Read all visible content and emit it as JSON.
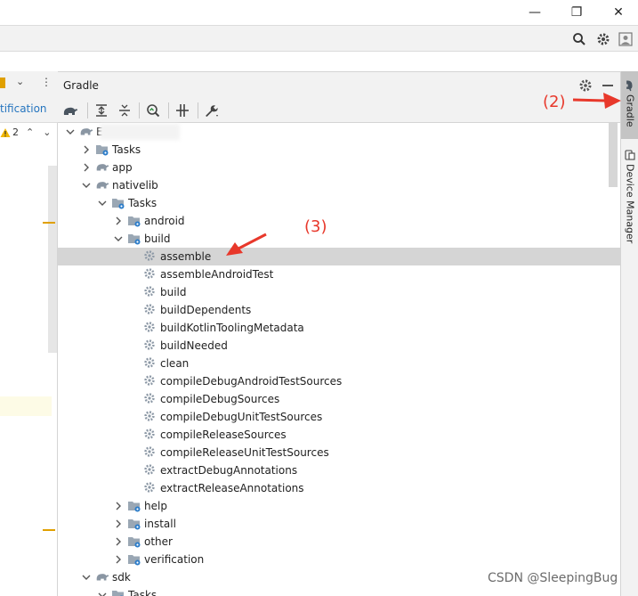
{
  "window": {
    "minimize_glyph": "—",
    "maximize_glyph": "❐",
    "close_glyph": "✕"
  },
  "left_panel": {
    "link_text": "tification",
    "warning_count": "2"
  },
  "gradle": {
    "title": "Gradle",
    "tree": [
      {
        "label": "E          ore",
        "depth": 0,
        "state": "open",
        "icon": "gradle-elephant-icon"
      },
      {
        "label": "Tasks",
        "depth": 1,
        "state": "closed",
        "icon": "folder-gear-icon"
      },
      {
        "label": "app",
        "depth": 1,
        "state": "closed",
        "icon": "gradle-elephant-icon"
      },
      {
        "label": "nativelib",
        "depth": 1,
        "state": "open",
        "icon": "gradle-elephant-icon"
      },
      {
        "label": "Tasks",
        "depth": 2,
        "state": "open",
        "icon": "folder-gear-icon"
      },
      {
        "label": "android",
        "depth": 3,
        "state": "closed",
        "icon": "folder-gear-icon"
      },
      {
        "label": "build",
        "depth": 3,
        "state": "open",
        "icon": "folder-gear-icon"
      },
      {
        "label": "assemble",
        "depth": 4,
        "state": "leaf",
        "icon": "gear-icon",
        "selected": true
      },
      {
        "label": "assembleAndroidTest",
        "depth": 4,
        "state": "leaf",
        "icon": "gear-icon"
      },
      {
        "label": "build",
        "depth": 4,
        "state": "leaf",
        "icon": "gear-icon"
      },
      {
        "label": "buildDependents",
        "depth": 4,
        "state": "leaf",
        "icon": "gear-icon"
      },
      {
        "label": "buildKotlinToolingMetadata",
        "depth": 4,
        "state": "leaf",
        "icon": "gear-icon"
      },
      {
        "label": "buildNeeded",
        "depth": 4,
        "state": "leaf",
        "icon": "gear-icon"
      },
      {
        "label": "clean",
        "depth": 4,
        "state": "leaf",
        "icon": "gear-icon"
      },
      {
        "label": "compileDebugAndroidTestSources",
        "depth": 4,
        "state": "leaf",
        "icon": "gear-icon"
      },
      {
        "label": "compileDebugSources",
        "depth": 4,
        "state": "leaf",
        "icon": "gear-icon"
      },
      {
        "label": "compileDebugUnitTestSources",
        "depth": 4,
        "state": "leaf",
        "icon": "gear-icon"
      },
      {
        "label": "compileReleaseSources",
        "depth": 4,
        "state": "leaf",
        "icon": "gear-icon"
      },
      {
        "label": "compileReleaseUnitTestSources",
        "depth": 4,
        "state": "leaf",
        "icon": "gear-icon"
      },
      {
        "label": "extractDebugAnnotations",
        "depth": 4,
        "state": "leaf",
        "icon": "gear-icon"
      },
      {
        "label": "extractReleaseAnnotations",
        "depth": 4,
        "state": "leaf",
        "icon": "gear-icon"
      },
      {
        "label": "help",
        "depth": 3,
        "state": "closed",
        "icon": "folder-gear-icon"
      },
      {
        "label": "install",
        "depth": 3,
        "state": "closed",
        "icon": "folder-gear-icon"
      },
      {
        "label": "other",
        "depth": 3,
        "state": "closed",
        "icon": "folder-gear-icon"
      },
      {
        "label": "verification",
        "depth": 3,
        "state": "closed",
        "icon": "folder-gear-icon"
      },
      {
        "label": "sdk",
        "depth": 1,
        "state": "open",
        "icon": "gradle-elephant-icon"
      },
      {
        "label": "Tasks",
        "depth": 2,
        "state": "open",
        "icon": "folder-gear-icon"
      }
    ]
  },
  "right_strip": {
    "gradle_tab": "Gradle",
    "device_manager_tab": "Device Manager"
  },
  "annotations": {
    "step2": "(2)",
    "step3": "(3)",
    "color": "#e8382b"
  },
  "watermark": "CSDN @SleepingBug"
}
